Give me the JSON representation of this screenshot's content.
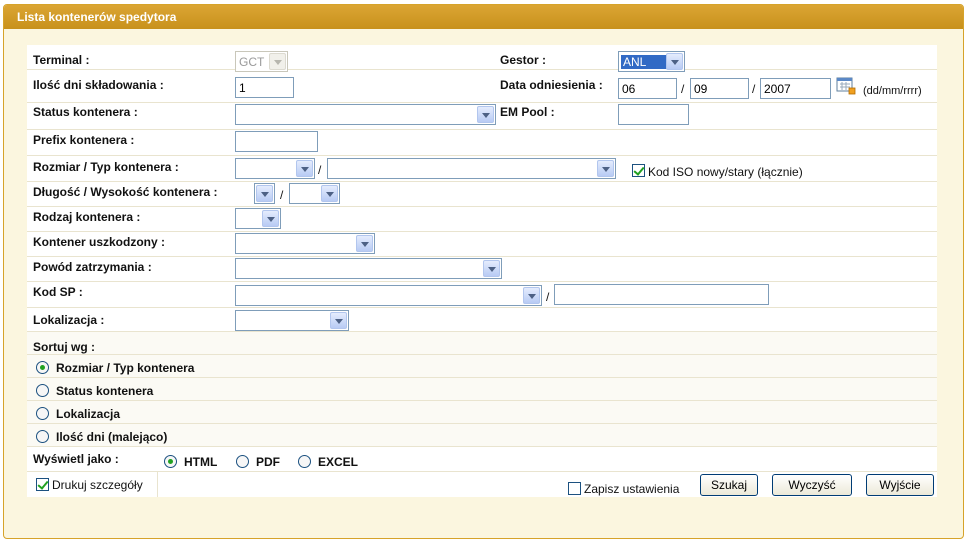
{
  "panel": {
    "title": "Lista kontenerów spedytora"
  },
  "fields": {
    "terminal": {
      "label": "Terminal :",
      "value": "GCT"
    },
    "gestor": {
      "label": "Gestor :",
      "value": "ANL"
    },
    "storage_days": {
      "label": "Ilość dni składowania :",
      "value": "1"
    },
    "reference_date": {
      "label": "Data odniesienia :",
      "day": "06",
      "month": "09",
      "year": "2007",
      "format_hint": "(dd/mm/rrrr)"
    },
    "container_status": {
      "label": "Status kontenera :",
      "value": ""
    },
    "em_pool": {
      "label": "EM Pool :",
      "value": ""
    },
    "container_prefix": {
      "label": "Prefix kontenera :",
      "value": ""
    },
    "size_type": {
      "label": "Rozmiar / Typ kontenera :",
      "size_value": "",
      "type_value": "",
      "iso_checkbox_label": "Kod ISO nowy/stary (łącznie)",
      "iso_checked": true
    },
    "length_height": {
      "label": "Długość / Wysokość kontenera :",
      "length_value": "",
      "height_value": ""
    },
    "container_kind": {
      "label": "Rodzaj kontenera :",
      "value": ""
    },
    "damaged": {
      "label": "Kontener uszkodzony :",
      "value": ""
    },
    "hold_reason": {
      "label": "Powód zatrzymania :",
      "value": ""
    },
    "sp_code": {
      "label": "Kod SP :",
      "select_value": "",
      "text_value": ""
    },
    "location": {
      "label": "Lokalizacja :",
      "value": ""
    }
  },
  "sort": {
    "label": "Sortuj wg :",
    "options": [
      {
        "label": "Rozmiar / Typ kontenera",
        "checked": true
      },
      {
        "label": "Status kontenera",
        "checked": false
      },
      {
        "label": "Lokalizacja",
        "checked": false
      },
      {
        "label": "Ilość dni (malejąco)",
        "checked": false
      }
    ]
  },
  "display": {
    "label": "Wyświetl jako :",
    "options": [
      {
        "label": "HTML",
        "checked": true
      },
      {
        "label": "PDF",
        "checked": false
      },
      {
        "label": "EXCEL",
        "checked": false
      }
    ]
  },
  "footer": {
    "print_details_label": "Drukuj szczegóły",
    "print_details_checked": true,
    "save_settings_label": "Zapisz ustawienia",
    "save_settings_checked": false,
    "search_button": "Szukaj",
    "clear_button": "Wyczyść",
    "exit_button": "Wyjście"
  }
}
